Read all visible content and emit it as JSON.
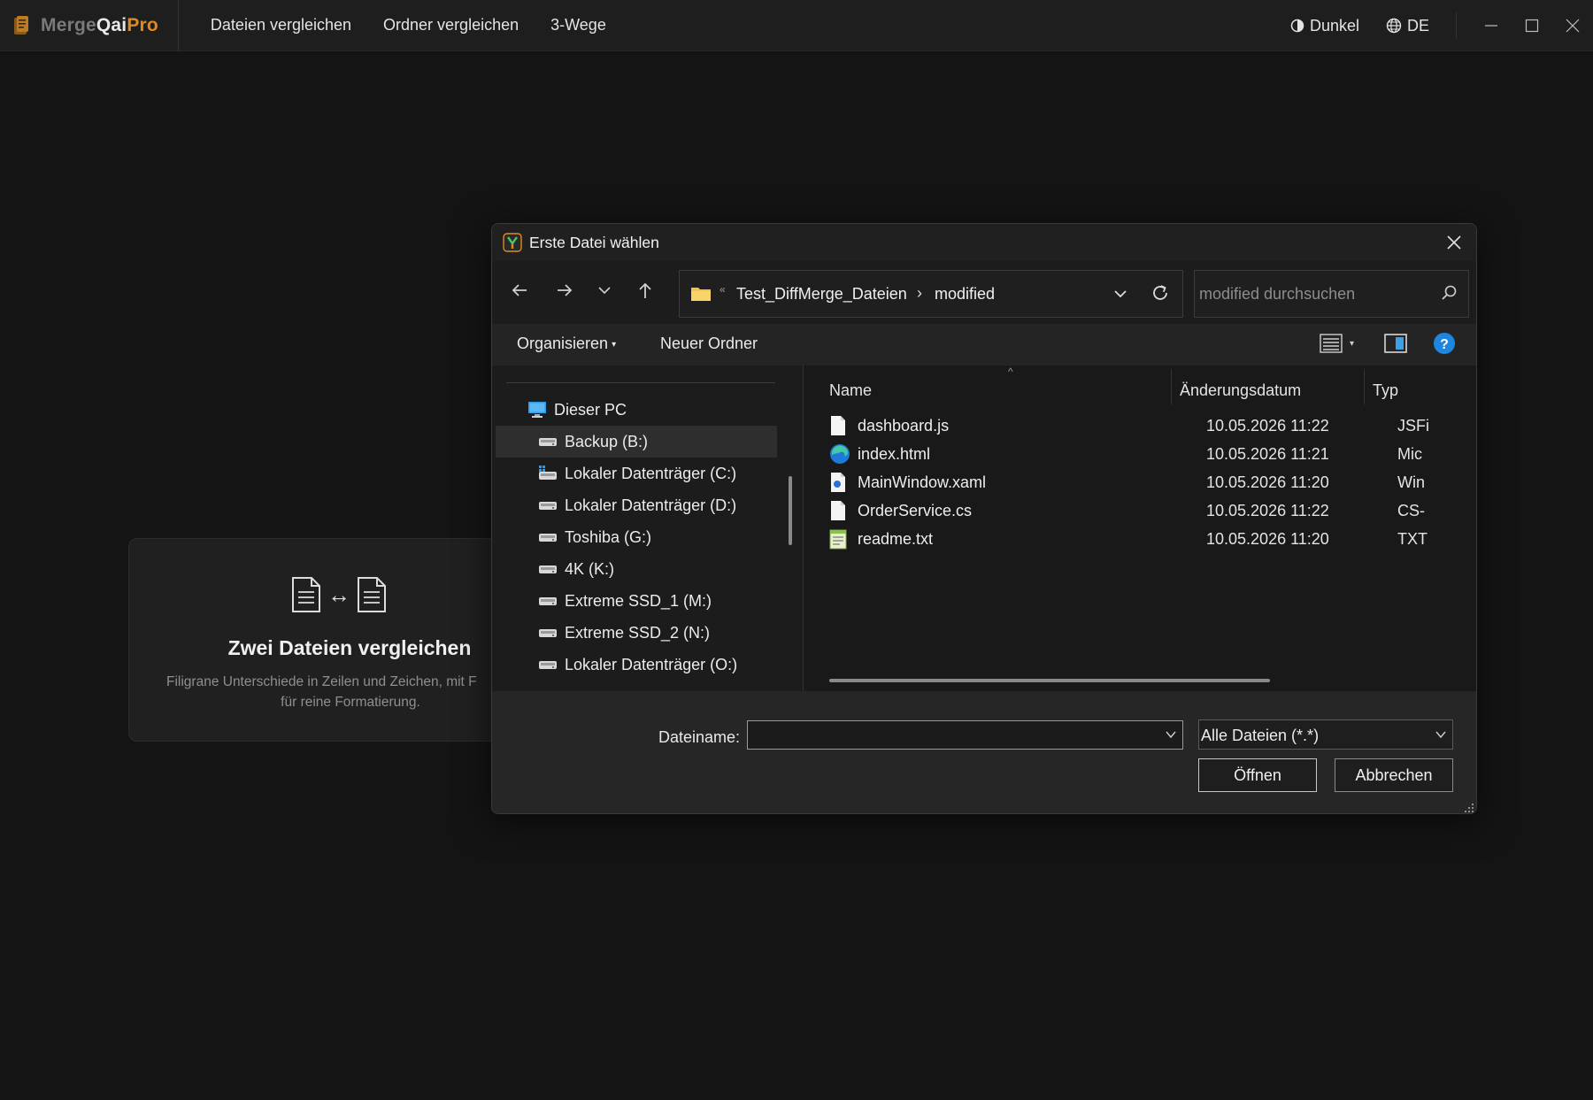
{
  "app": {
    "brand": {
      "part1": "Merge",
      "part2": "Qai",
      "part3": "Pro"
    },
    "nav": [
      "Dateien vergleichen",
      "Ordner vergleichen",
      "3-Wege"
    ],
    "theme_label": "Dunkel",
    "lang_label": "DE",
    "colors": {
      "accent": "#e08a1e",
      "background": "#141414"
    }
  },
  "card": {
    "title": "Zwei Dateien vergleichen",
    "desc_line1": "Filigrane Unterschiede in Zeilen und Zeichen, mit F",
    "desc_line2": "für reine Formatierung."
  },
  "dialog": {
    "title": "Erste Datei wählen",
    "address": {
      "segment1": "Test_DiffMerge_Dateien",
      "segment2": "modified"
    },
    "search_placeholder": "modified durchsuchen",
    "toolbar": {
      "organize": "Organisieren",
      "new_folder": "Neuer Ordner"
    },
    "tree": [
      {
        "label": "Dieser PC",
        "icon": "pc-icon",
        "selected": false
      },
      {
        "label": "Backup (B:)",
        "icon": "drive-icon",
        "selected": true
      },
      {
        "label": "Lokaler Datenträger (C:)",
        "icon": "system-drive-icon",
        "selected": false
      },
      {
        "label": "Lokaler Datenträger (D:)",
        "icon": "drive-icon",
        "selected": false
      },
      {
        "label": "Toshiba (G:)",
        "icon": "drive-icon",
        "selected": false
      },
      {
        "label": "4K (K:)",
        "icon": "drive-icon",
        "selected": false
      },
      {
        "label": "Extreme SSD_1 (M:)",
        "icon": "drive-icon",
        "selected": false
      },
      {
        "label": "Extreme SSD_2 (N:)",
        "icon": "drive-icon",
        "selected": false
      },
      {
        "label": "Lokaler Datenträger (O:)",
        "icon": "drive-icon",
        "selected": false
      }
    ],
    "columns": {
      "name": "Name",
      "date": "Änderungsdatum",
      "type": "Typ"
    },
    "files": [
      {
        "name": "dashboard.js",
        "date": "10.05.2026 11:22",
        "type": "JSFi",
        "icon": "file-icon"
      },
      {
        "name": "index.html",
        "date": "10.05.2026 11:21",
        "type": "Mic",
        "icon": "edge-icon"
      },
      {
        "name": "MainWindow.xaml",
        "date": "10.05.2026 11:20",
        "type": "Win",
        "icon": "xaml-file-icon"
      },
      {
        "name": "OrderService.cs",
        "date": "10.05.2026 11:22",
        "type": "CS-",
        "icon": "file-icon"
      },
      {
        "name": "readme.txt",
        "date": "10.05.2026 11:20",
        "type": "TXT",
        "icon": "notepad-icon"
      }
    ],
    "filename_label": "Dateiname:",
    "filename_value": "",
    "filter": "Alle Dateien (*.*)",
    "open_button": "Öffnen",
    "cancel_button": "Abbrechen"
  }
}
